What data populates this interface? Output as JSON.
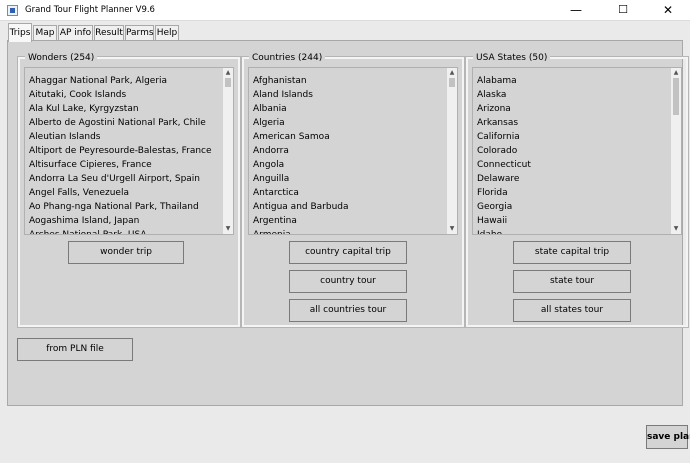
{
  "window": {
    "title": "Grand Tour Flight Planner V9.6",
    "controls": {
      "minimize": "—",
      "maximize": "☐",
      "close": "✕"
    }
  },
  "tabs": [
    {
      "label": "Trips",
      "active": true
    },
    {
      "label": "Map"
    },
    {
      "label": "AP info"
    },
    {
      "label": "Result"
    },
    {
      "label": "Parms"
    },
    {
      "label": "Help"
    }
  ],
  "wonders": {
    "title": "Wonders (254)",
    "items": [
      "Ahaggar National Park, Algeria",
      "Aitutaki, Cook Islands",
      "Ala Kul Lake, Kyrgyzstan",
      "Alberto de Agostini National Park, Chile",
      "Aleutian Islands",
      "Altiport de Peyresourde-Balestas, France",
      "Altisurface Cipieres, France",
      "Andorra La Seu d'Urgell Airport, Spain",
      "Angel Falls, Venezuela",
      "Ao Phang-nga National Park, Thailand",
      "Aogashima Island, Japan",
      "Arches National Park, USA"
    ],
    "scroll_thumb_fraction": 0.06,
    "buttons": [
      "wonder trip"
    ]
  },
  "countries": {
    "title": "Countries (244)",
    "items": [
      "Afghanistan",
      "Aland Islands",
      "Albania",
      "Algeria",
      "American Samoa",
      "Andorra",
      "Angola",
      "Anguilla",
      "Antarctica",
      "Antigua and Barbuda",
      "Argentina",
      "Armenia"
    ],
    "scroll_thumb_fraction": 0.06,
    "buttons": [
      "country capital trip",
      "country tour",
      "all countries tour"
    ]
  },
  "states": {
    "title": "USA States (50)",
    "items": [
      "Alabama",
      "Alaska",
      "Arizona",
      "Arkansas",
      "California",
      "Colorado",
      "Connecticut",
      "Delaware",
      "Florida",
      "Georgia",
      "Hawaii",
      "Idaho"
    ],
    "scroll_thumb_fraction": 0.25,
    "buttons": [
      "state capital trip",
      "state tour",
      "all states tour"
    ]
  },
  "from_pln_button": "from PLN file",
  "save_plan_button": "save plan"
}
